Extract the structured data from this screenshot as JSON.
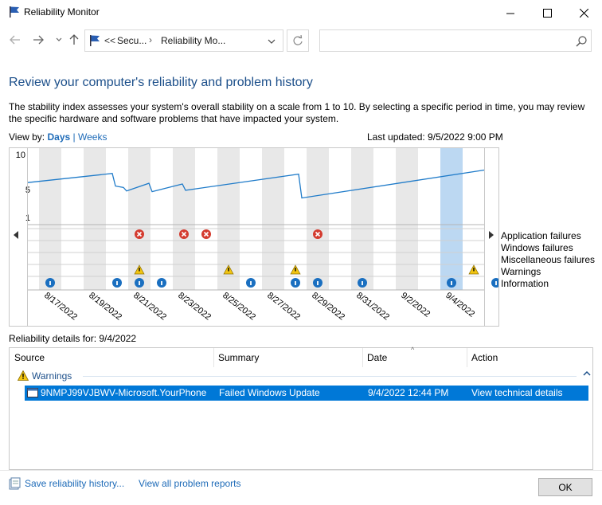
{
  "window": {
    "title": "Reliability Monitor"
  },
  "address": {
    "crumb_prefix": "<<",
    "crumb1": "Secu...",
    "crumb2": "Reliability Mo..."
  },
  "heading": "Review your computer's reliability and problem history",
  "description": "The stability index assesses your system's overall stability on a scale from 1 to 10. By selecting a specific period in time, you may review the specific hardware and software problems that have impacted your system.",
  "view_by": {
    "label": "View by:",
    "days": "Days",
    "separator": "|",
    "weeks": "Weeks"
  },
  "last_updated": "Last updated: 9/5/2022 9:00 PM",
  "chart": {
    "y_ticks": [
      "10",
      "5",
      "1"
    ],
    "x_labels": [
      "8/17/2022",
      "8/19/2022",
      "8/21/2022",
      "8/23/2022",
      "8/25/2022",
      "8/27/2022",
      "8/29/2022",
      "8/31/2022",
      "9/2/2022",
      "9/4/2022"
    ],
    "row_labels": [
      "Application failures",
      "Windows failures",
      "Miscellaneous failures",
      "Warnings",
      "Information"
    ],
    "selected_day": "9/4/2022",
    "app_failure_days": [
      4,
      6,
      7,
      12
    ],
    "warning_days": [
      4,
      8,
      11,
      19
    ],
    "information_days": [
      0,
      3,
      4,
      5,
      9,
      11,
      12,
      14,
      18,
      20
    ],
    "colors": {
      "line": "#1f7bc9",
      "error": "#d43b2f",
      "warning": "#f2c511",
      "info": "#1a6fc0",
      "selected": "#bcd8f2",
      "shaded": "#e8e8e8"
    }
  },
  "details": {
    "label": "Reliability details for: 9/4/2022",
    "columns": [
      "Source",
      "Summary",
      "Date",
      "Action"
    ],
    "group": "Warnings",
    "row": {
      "source": "9NMPJ99VJBWV-Microsoft.YourPhone",
      "summary": "Failed Windows Update",
      "date": "9/4/2022 12:44 PM",
      "action": "View technical details"
    }
  },
  "footer": {
    "save": "Save reliability history...",
    "reports": "View all problem reports",
    "ok": "OK"
  }
}
